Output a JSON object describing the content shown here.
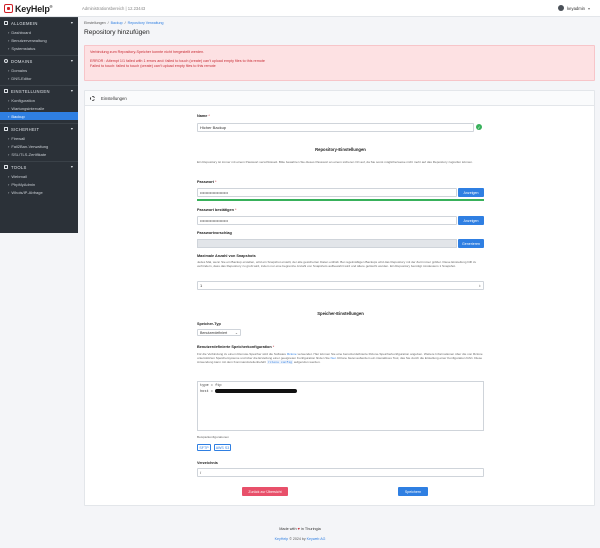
{
  "header": {
    "logo_text": "KeyHelp",
    "logo_mark": "®",
    "area_label": "Administrationsbereich | 12.23443",
    "user_name": "keyadmin"
  },
  "sidebar": {
    "sections": [
      {
        "title": "ALLGEMEIN",
        "icon": "grid-icon",
        "items": [
          "Dashboard",
          "Benutzerverwaltung",
          "Systemstatus"
        ]
      },
      {
        "title": "DOMAINS",
        "icon": "globe-icon",
        "items": [
          "Domains",
          "DNS-Editor"
        ]
      },
      {
        "title": "EINSTELLUNGEN",
        "icon": "sliders-icon",
        "items": [
          "Konfiguration",
          "Wartungsintervalle",
          "Backup"
        ]
      },
      {
        "title": "SICHERHEIT",
        "icon": "shield-icon",
        "items": [
          "Firewall",
          "Fail2Ban-Verwaltung",
          "SSL/TLS-Zertifikate"
        ]
      },
      {
        "title": "TOOLS",
        "icon": "wrench-icon",
        "items": [
          "Webmail",
          "PhpMyAdmin",
          "Whois/IP-Abfrage"
        ]
      }
    ],
    "active_item": "Backup"
  },
  "breadcrumb": [
    "Einstellungen",
    "Backup",
    "Repository Verwaltung"
  ],
  "page_title": "Repository hinzufügen",
  "alert": {
    "line1": "Verbindung zum Repository-Speicher konnte nicht hergestellt werden.",
    "line2": "ERROR : Attempt 1/1 failed with 1 errors and: failed to touch (create) can't upload empty files to this remote",
    "line3": "Failed to touch: failed to touch (create) can't upload empty files to this remote"
  },
  "card_title": "Einstellungen",
  "form": {
    "name_label": "Name",
    "name_value": "Hicher Backup",
    "repo_settings_title": "Repository-Einstellungen",
    "repo_settings_help": "Ein Repository ist immer mit einem Passwort verschlüsselt. Bitte bewahren Sie dieses Passwort an einem sicheren Ort auf, da Sie sonst möglicherweise nicht mehr auf das Repository zugreifen können.",
    "password_label": "Passwort",
    "password_value": "••••••••••••••••••••",
    "show_label": "Anzeigen",
    "password_confirm_label": "Passwort bestätigen",
    "password_confirm_value": "••••••••••••••••••••",
    "suggestion_label": "Passwortvorschlag",
    "generate_label": "Generieren",
    "snapshots_label": "Maximale Anzahl von Snapshots",
    "snapshots_help": "Jedes Mal, wenn Sie ein Backup erstellen, wird ein Snapshot erstellt, der alle gesicherten Daten enthält. Bei regelmäßigen Backups wird das Repository mit der Zeit immer größer. Diese Einstellung hilft zu verhindern, dass das Repository zu groß wird, indem nur eine begrenzte Anzahl von Snapshots aufbewahrt wird und ältere gelöscht werden. Ein Repository benötigt mindestens 1 Snapshot.",
    "snapshots_value": "1",
    "storage_title": "Speicher-Einstellungen",
    "storage_type_label": "Speicher-Typ",
    "storage_type_value": "Benutzerdefiniert",
    "custom_config_label": "Benutzerdefinierte Speicherkonfiguration",
    "custom_help_1": "Für die Verbindung zu einem Remote-Speicher wird die Software",
    "custom_help_rclone": "Rclone",
    "custom_help_2": "verwendet. Hier können Sie eine benutzerdefinierte Rclone-Speicherkonfiguration angeben. Weitere Informationen über die von Rclone unterstützten Speichersysteme und über die Erstellung einer geeigneten Konfiguration finden Sie",
    "custom_help_link": "hier",
    "custom_help_3": ". Rclone bietet außerdem ein interaktives Tool, das Sie durch die Erstellung einer Konfiguration führt. Diese Anwendung kann mit dem Kommandozeilenbefehl",
    "custom_help_code": "rclone config",
    "custom_help_4": "aufgerufen werden.",
    "config_line1": "type = ftp",
    "config_line2": "host = ",
    "examples_label": "Beispielkonfigurationen",
    "example_sftp": "SFTP",
    "example_aws": "AWS S3",
    "directory_label": "Verzeichnis",
    "directory_value": "/"
  },
  "buttons": {
    "back": "Zurück zur Übersicht",
    "save": "Speichern"
  },
  "footer": {
    "made_with": "Made with",
    "in": "in Thuringia",
    "copyright_prefix": "KeyHelp",
    "copyright_mid": "© 2024 by",
    "company": "Keyweb AG"
  }
}
